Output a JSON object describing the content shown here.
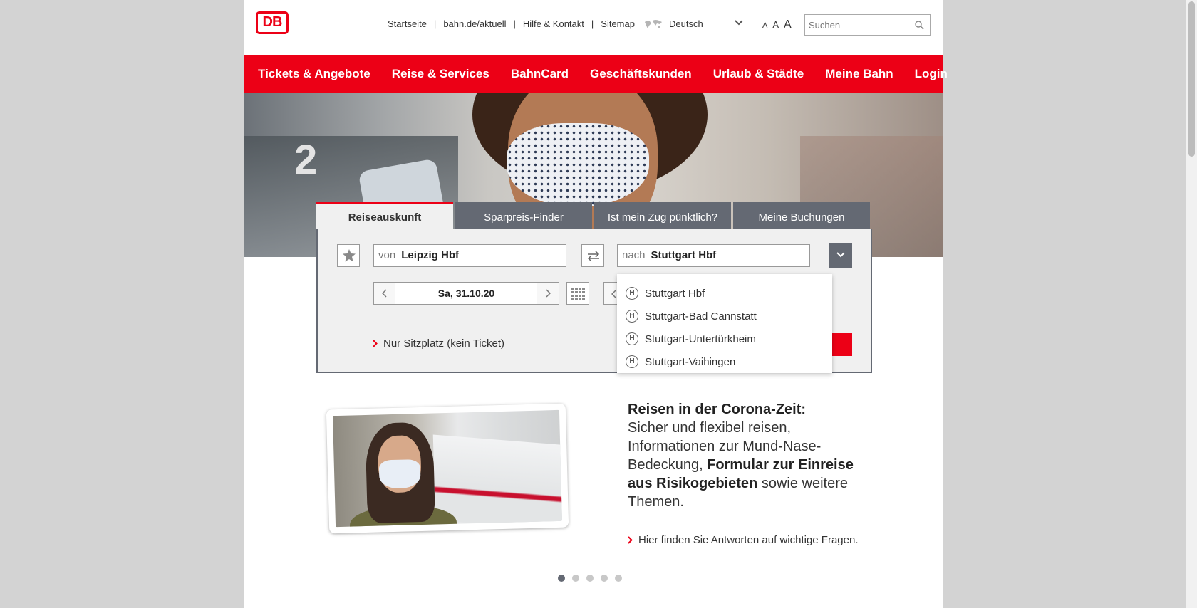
{
  "logo": "DB",
  "topnav": {
    "items": [
      "Startseite",
      "bahn.de/aktuell",
      "Hilfe & Kontakt",
      "Sitemap"
    ],
    "language": "Deutsch",
    "font_sizes": [
      "A",
      "A",
      "A"
    ],
    "search_placeholder": "Suchen"
  },
  "mainnav": [
    "Tickets & Angebote",
    "Reise & Services",
    "BahnCard",
    "Geschäftskunden",
    "Urlaub & Städte",
    "Meine Bahn",
    "Login"
  ],
  "booking": {
    "tabs": [
      "Reiseauskunft",
      "Sparpreis-Finder",
      "Ist mein Zug pünktlich?",
      "Meine Buchungen"
    ],
    "active_tab": "Reiseauskunft",
    "from_prefix": "von",
    "from_value": "Leipzig Hbf",
    "to_prefix": "nach",
    "to_value": "Stuttgart Hbf",
    "date": "Sa, 31.10.20",
    "seat_only": "Nur Sitzplatz (kein Ticket)",
    "suggestions": [
      {
        "badge": "H",
        "label": "Stuttgart Hbf"
      },
      {
        "badge": "H",
        "label": "Stuttgart-Bad Cannstatt"
      },
      {
        "badge": "H",
        "label": "Stuttgart-Untertürkheim"
      },
      {
        "badge": "H",
        "label": "Stuttgart-Vaihingen"
      }
    ]
  },
  "teaser": {
    "heading": "Reisen in der Corona-Zeit:",
    "text1": "Sicher und flexibel reisen, Informationen zur Mund-Nase-Bedeckung, ",
    "bold2": "Formular zur Einreise aus Risikogebieten",
    "text3": " sowie weitere Themen.",
    "link": "Hier finden Sie Antworten auf wichtige Fragen."
  },
  "carousel": {
    "count": 5,
    "active": 1
  },
  "colors": {
    "brand_red": "#ec0016",
    "tab_gray": "#646973",
    "panel_bg": "#f0f0f0"
  }
}
